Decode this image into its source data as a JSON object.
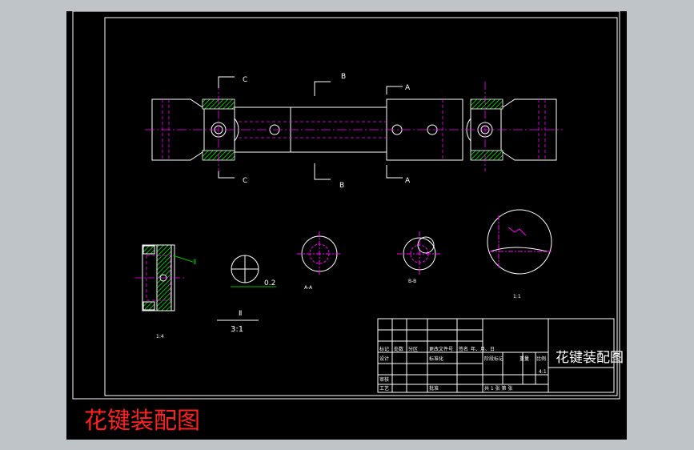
{
  "drawing": {
    "title_block_name": "花键装配图",
    "section_labels": {
      "a": "A",
      "b": "B",
      "c": "C"
    },
    "detail": {
      "label": "Ⅱ",
      "scale": "3:1",
      "dimension": "0.2"
    },
    "small_notes": {
      "note_a": "1:4",
      "note_b": "A-A",
      "note_c": "B-B",
      "note_d": "1:1"
    }
  },
  "title_block": {
    "row_labels": [
      "标记",
      "处数",
      "分区",
      "更改文件号",
      "签名",
      "年、月、日"
    ],
    "design_label": "设计",
    "standard_label": "标准化",
    "review_label": "审核",
    "process_label": "工艺",
    "approve_label": "批准",
    "stage_mark_label": "阶段标记",
    "weight_label": "重量",
    "ratio_label": "比例",
    "ratio_value": "4:1",
    "sheet_text": "共 1 张  第 张"
  },
  "caption": "花键装配图",
  "colors": {
    "background": "#000000",
    "line_white": "#ffffff",
    "centerline_magenta": "#ff00ff",
    "hatch_green": "#00c000",
    "caption_red": "#ff2020",
    "frame_gray": "#bfc4c9"
  }
}
